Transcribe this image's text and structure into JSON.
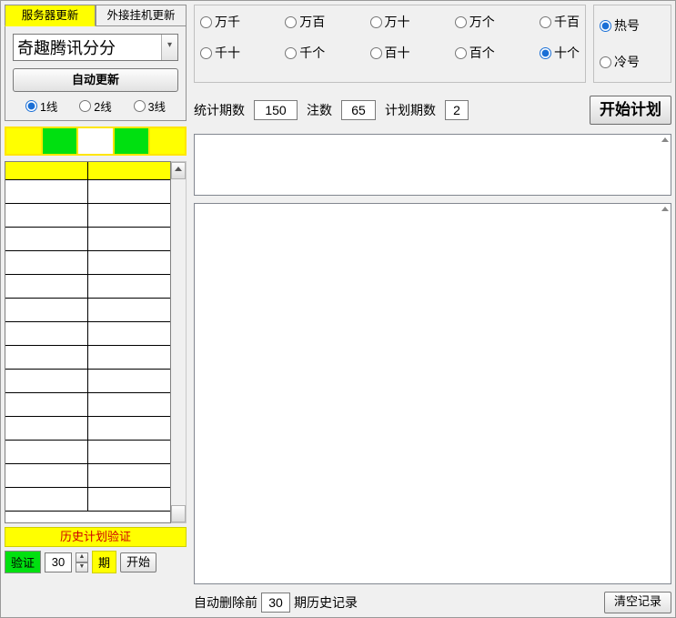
{
  "tabs": {
    "server_update": "服务器更新",
    "external_update": "外接挂机更新"
  },
  "dropdown_value": "奇趣腾讯分分",
  "auto_update_btn": "自动更新",
  "lines": {
    "l1": "1线",
    "l2": "2线",
    "l3": "3线"
  },
  "history_title": "历史计划验证",
  "verify_label": "验证",
  "verify_value": "30",
  "period_label": "期",
  "start_small_btn": "开始",
  "positions": {
    "row1": [
      "万千",
      "万百",
      "万十",
      "万个",
      "千百"
    ],
    "row2": [
      "千十",
      "千个",
      "百十",
      "百个",
      "十个"
    ]
  },
  "selected_position": "十个",
  "hotcold": {
    "hot": "热号",
    "cold": "冷号"
  },
  "stats": {
    "stat_periods_label": "统计期数",
    "stat_periods_value": "150",
    "bets_label": "注数",
    "bets_value": "65",
    "plan_periods_label": "计划期数",
    "plan_periods_value": "2"
  },
  "start_plan_btn": "开始计划",
  "bottom": {
    "auto_del_prefix": "自动删除前",
    "auto_del_value": "30",
    "auto_del_suffix": "期历史记录",
    "clear_btn": "清空记录"
  },
  "chart_data": {
    "type": "table",
    "title": "",
    "columns": [
      "",
      ""
    ],
    "rows": []
  }
}
